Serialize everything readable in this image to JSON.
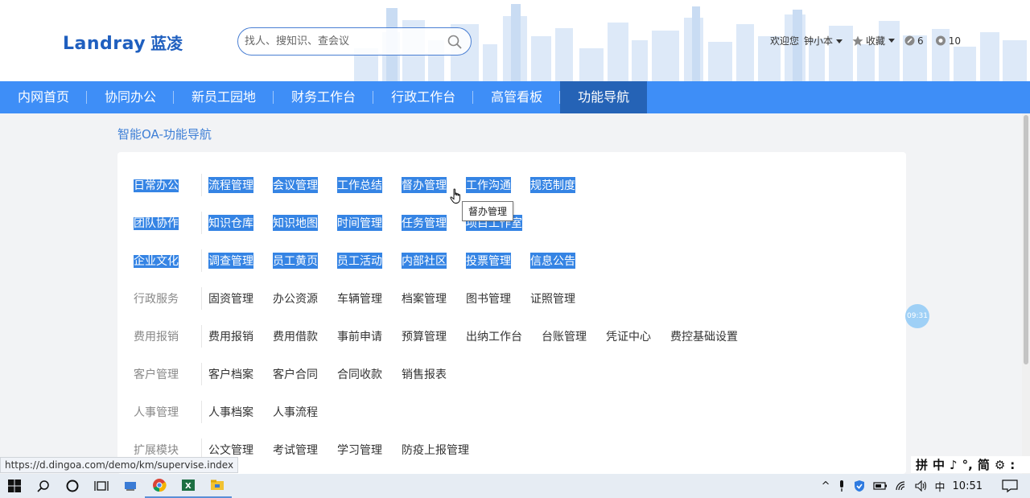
{
  "header": {
    "logo_en": "Landray",
    "logo_cn": "蓝凌",
    "search_placeholder": "找人、搜知识、查会议",
    "welcome": "欢迎您",
    "user": "钟小本",
    "favorites": "收藏",
    "count_a": "6",
    "count_b": "10"
  },
  "nav": {
    "items": [
      "内网首页",
      "协同办公",
      "新员工园地",
      "财务工作台",
      "行政工作台",
      "高管看板",
      "功能导航"
    ],
    "active_index": 6
  },
  "page_title": "智能OA-功能导航",
  "sections": [
    {
      "category": "日常办公",
      "links": [
        "流程管理",
        "会议管理",
        "工作总结",
        "督办管理",
        "工作沟通",
        "规范制度"
      ]
    },
    {
      "category": "团队协作",
      "links": [
        "知识仓库",
        "知识地图",
        "时间管理",
        "任务管理",
        "项目工作室"
      ]
    },
    {
      "category": "企业文化",
      "links": [
        "调查管理",
        "员工黄页",
        "员工活动",
        "内部社区",
        "投票管理",
        "信息公告"
      ]
    },
    {
      "category": "行政服务",
      "links": [
        "固资管理",
        "办公资源",
        "车辆管理",
        "档案管理",
        "图书管理",
        "证照管理"
      ]
    },
    {
      "category": "费用报销",
      "links": [
        "费用报销",
        "费用借款",
        "事前申请",
        "预算管理",
        "出纳工作台",
        "台账管理",
        "凭证中心",
        "费控基础设置"
      ]
    },
    {
      "category": "客户管理",
      "links": [
        "客户档案",
        "客户合同",
        "合同收款",
        "销售报表"
      ]
    },
    {
      "category": "人事管理",
      "links": [
        "人事档案",
        "人事流程"
      ]
    },
    {
      "category": "扩展模块",
      "links": [
        "公文管理",
        "考试管理",
        "学习管理",
        "防疫上报管理"
      ]
    }
  ],
  "tooltip": "督办管理",
  "clock_bubble": "09:31",
  "status_url": "https://d.dingoa.com/demo/km/supervise.index",
  "ime": [
    "拼",
    "中",
    "♪",
    "°,",
    "简",
    "⚙",
    ":"
  ],
  "tray": {
    "lang": "中",
    "time": "10:51"
  },
  "colors": {
    "nav_bg": "#3e8ef7",
    "nav_active": "#2563b6",
    "selection": "#3584e4",
    "title": "#3e7fd6"
  }
}
